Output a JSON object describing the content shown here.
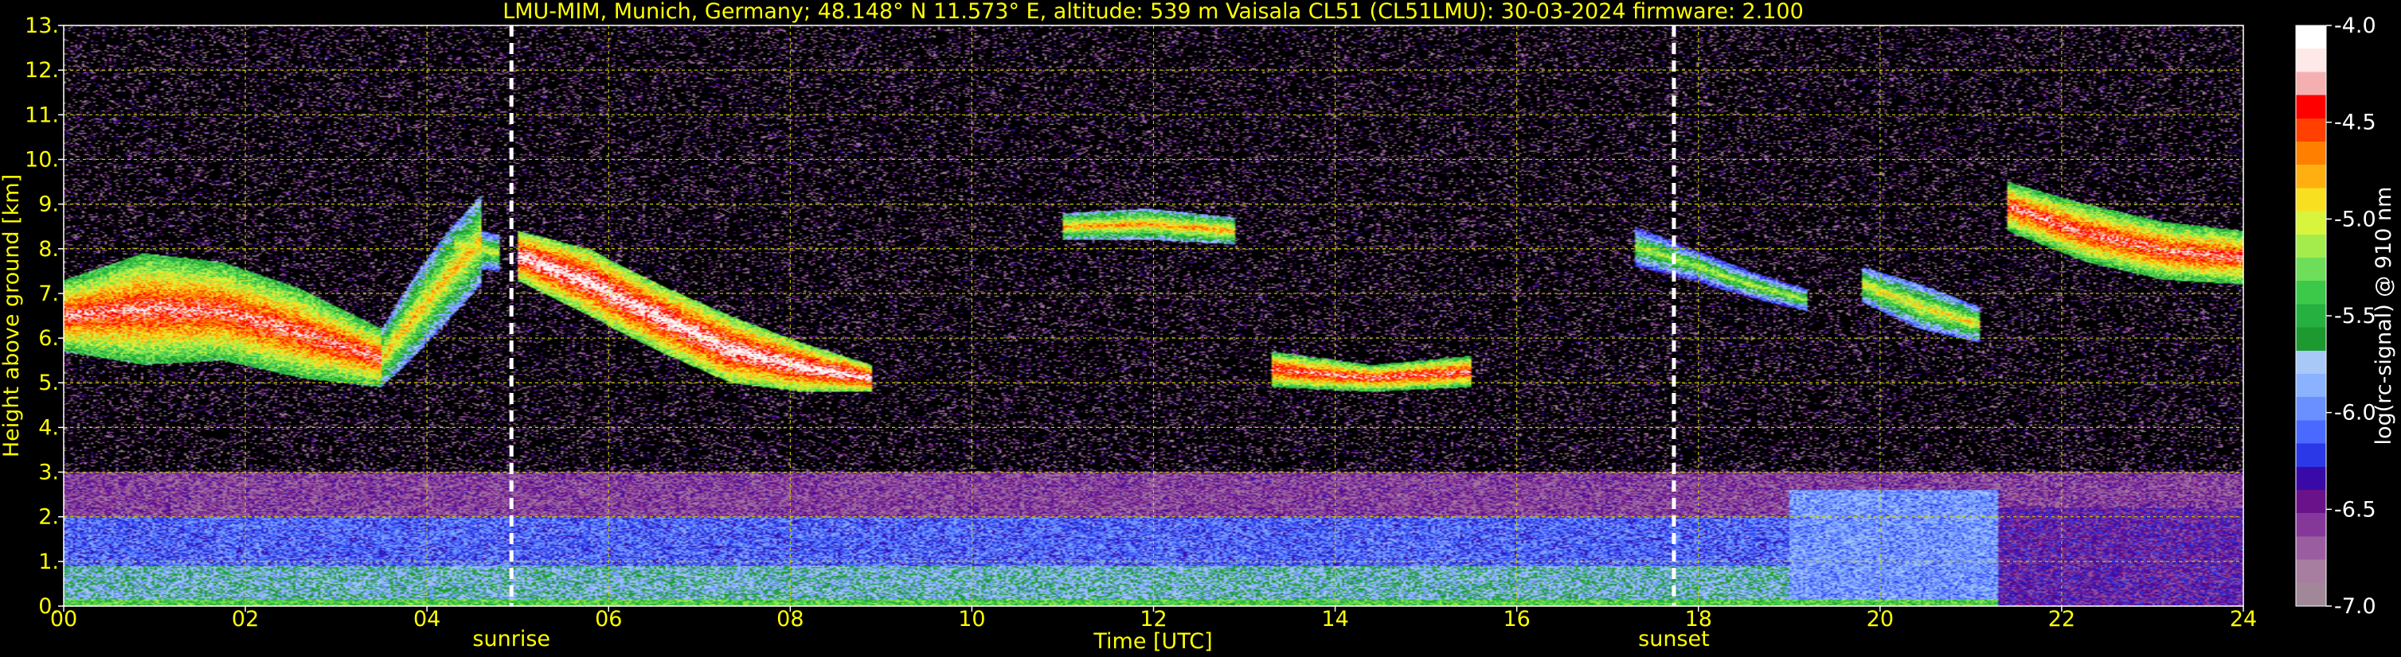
{
  "chart_data": {
    "type": "heatmap",
    "title": "LMU-MIM, Munich, Germany; 48.148° N 11.573° E, altitude: 539 m    Vaisala CL51 (CL51LMU): 30-03-2024    firmware: 2.100",
    "xlabel": "Time [UTC]",
    "ylabel": "Height above ground [km]",
    "colorbar_label": "log(rc-signal) @ 910 nm",
    "xlim": [
      0,
      24
    ],
    "ylim": [
      0,
      13
    ],
    "x_ticks": [
      0,
      2,
      4,
      6,
      8,
      10,
      12,
      14,
      16,
      18,
      20,
      22,
      24
    ],
    "x_tick_labels": [
      "00",
      "02",
      "04",
      "06",
      "08",
      "10",
      "12",
      "14",
      "16",
      "18",
      "20",
      "22",
      "24"
    ],
    "y_ticks": [
      0,
      1,
      2,
      3,
      4,
      5,
      6,
      7,
      8,
      9,
      10,
      11,
      12,
      13
    ],
    "y_tick_labels": [
      "0.",
      "1.",
      "2.",
      "3.",
      "4.",
      "5.",
      "6.",
      "7.",
      "8.",
      "9.",
      "10.",
      "11.",
      "12.",
      "13."
    ],
    "colorbar_range": [
      -7.0,
      -4.0
    ],
    "colorbar_ticks": [
      -4.0,
      -4.5,
      -5.0,
      -5.5,
      -6.0,
      -6.5,
      -7.0
    ],
    "colorbar_tick_labels": [
      "-4.0",
      "-4.5",
      "-5.0",
      "-5.5",
      "-6.0",
      "-6.5",
      "-7.0"
    ],
    "grid": true,
    "markers": [
      {
        "label": "sunrise",
        "time": 4.93
      },
      {
        "label": "sunset",
        "time": 17.73
      }
    ],
    "colors": {
      "axis_text": "#ffff00",
      "background": "#000000",
      "grid": "#cccc00",
      "marker_line": "#ffffff"
    },
    "colormap": [
      "#a08898",
      "#a87ea0",
      "#9a5ea0",
      "#86389a",
      "#6a128a",
      "#3a0aa8",
      "#2a38e8",
      "#4a6aff",
      "#6a90ff",
      "#8ab2ff",
      "#a8c8f8",
      "#1c9a30",
      "#26b040",
      "#3cc848",
      "#6ede5a",
      "#a4ec4c",
      "#d8f43c",
      "#f8e020",
      "#ffb010",
      "#ff8000",
      "#ff4000",
      "#ff0000",
      "#f4b0b0",
      "#ffe8e8",
      "#ffffff"
    ],
    "layers": [
      {
        "name": "surface",
        "t0": 0,
        "t1": 24,
        "z": [
          0.0,
          0.15
        ],
        "value": -5.35
      },
      {
        "name": "boundary_layer",
        "t0": 0,
        "t1": 24,
        "z": [
          0.15,
          0.9
        ],
        "value": -5.75
      },
      {
        "name": "residual_layer",
        "t0": 0,
        "t1": 24,
        "z": [
          0.9,
          2.0
        ],
        "value": -6.1
      },
      {
        "name": "upper_aerosol",
        "t0": 0,
        "t1": 24,
        "z": [
          2.0,
          3.0
        ],
        "value": -6.6
      }
    ],
    "clouds": [
      {
        "t0": 0.0,
        "t1": 3.5,
        "z_top": [
          7.3,
          7.9,
          7.7,
          7.1,
          6.2
        ],
        "z_base": [
          5.7,
          5.4,
          5.5,
          5.1,
          4.9
        ],
        "peak": -4.3
      },
      {
        "t0": 3.5,
        "t1": 4.6,
        "z_top": [
          6.2,
          7.4,
          8.4,
          9.2
        ],
        "z_base": [
          4.9,
          5.6,
          6.4,
          7.2
        ],
        "peak": -4.8
      },
      {
        "t0": 4.3,
        "t1": 4.8,
        "z_top": [
          8.6,
          8.3
        ],
        "z_base": [
          7.6,
          7.5
        ],
        "peak": -5.0
      },
      {
        "t0": 5.0,
        "t1": 8.9,
        "z_top": [
          8.4,
          8.0,
          7.2,
          6.5,
          5.9,
          5.4
        ],
        "z_base": [
          7.3,
          6.5,
          5.7,
          5.0,
          4.8,
          4.8
        ],
        "peak": -4.1
      },
      {
        "t0": 11.0,
        "t1": 12.9,
        "z_top": [
          8.8,
          8.9,
          8.7
        ],
        "z_base": [
          8.2,
          8.2,
          8.1
        ],
        "peak": -4.7
      },
      {
        "t0": 13.3,
        "t1": 15.5,
        "z_top": [
          5.7,
          5.4,
          5.6
        ],
        "z_base": [
          4.9,
          4.8,
          4.9
        ],
        "peak": -4.3
      },
      {
        "t0": 17.3,
        "t1": 19.2,
        "z_top": [
          8.5,
          8.0,
          7.5,
          7.1
        ],
        "z_base": [
          7.6,
          7.3,
          6.9,
          6.6
        ],
        "peak": -5.1
      },
      {
        "t0": 19.8,
        "t1": 21.1,
        "z_top": [
          7.6,
          7.2,
          6.7
        ],
        "z_base": [
          6.8,
          6.2,
          5.9
        ],
        "peak": -4.9
      },
      {
        "t0": 21.4,
        "t1": 24.0,
        "z_top": [
          9.5,
          9.0,
          8.6,
          8.4
        ],
        "z_base": [
          8.4,
          7.7,
          7.3,
          7.2
        ],
        "peak": -4.3
      }
    ]
  }
}
